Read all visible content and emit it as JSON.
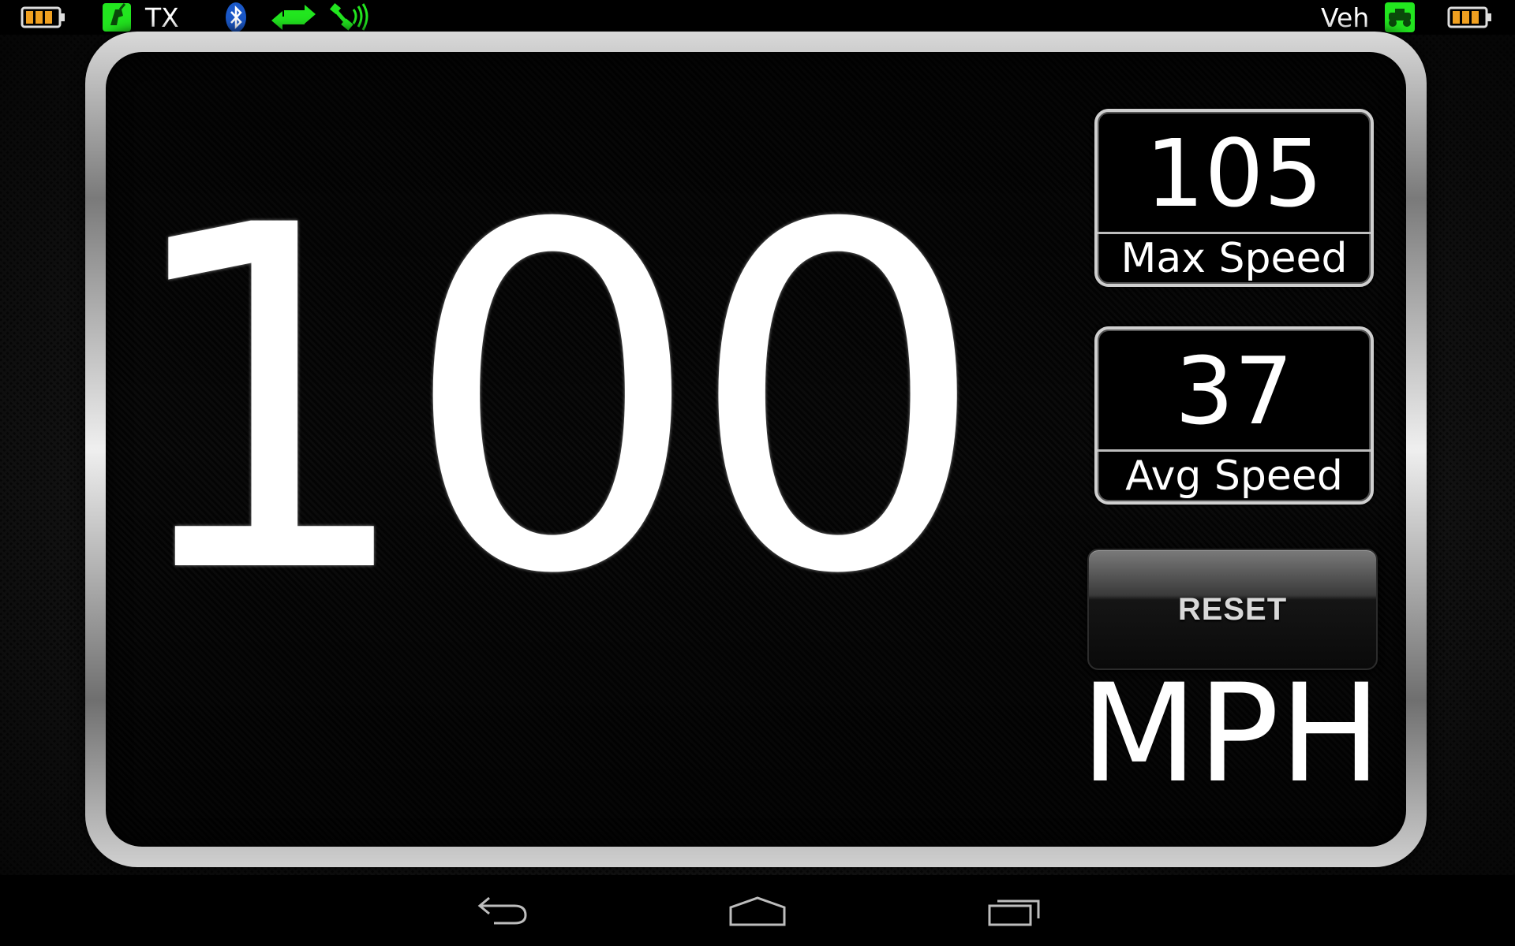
{
  "statusbar": {
    "tx_label": "TX",
    "veh_label": "Veh",
    "icons": [
      "battery-icon",
      "transmitter-icon",
      "bluetooth-icon",
      "data-transfer-icon",
      "telemetry-signal-icon",
      "vehicle-icon",
      "battery-icon"
    ]
  },
  "speedometer": {
    "current_speed": "100",
    "max_speed_value": "105",
    "max_speed_label": "Max Speed",
    "avg_speed_value": "37",
    "avg_speed_label": "Avg Speed",
    "reset_label": "RESET",
    "unit": "MPH"
  },
  "navbar": {
    "buttons": [
      "back-icon",
      "home-icon",
      "recent-apps-icon"
    ]
  },
  "colors": {
    "status_green": "#22e61f",
    "bluetooth_blue": "#1a58c8",
    "battery_orange": "#f0a020"
  }
}
